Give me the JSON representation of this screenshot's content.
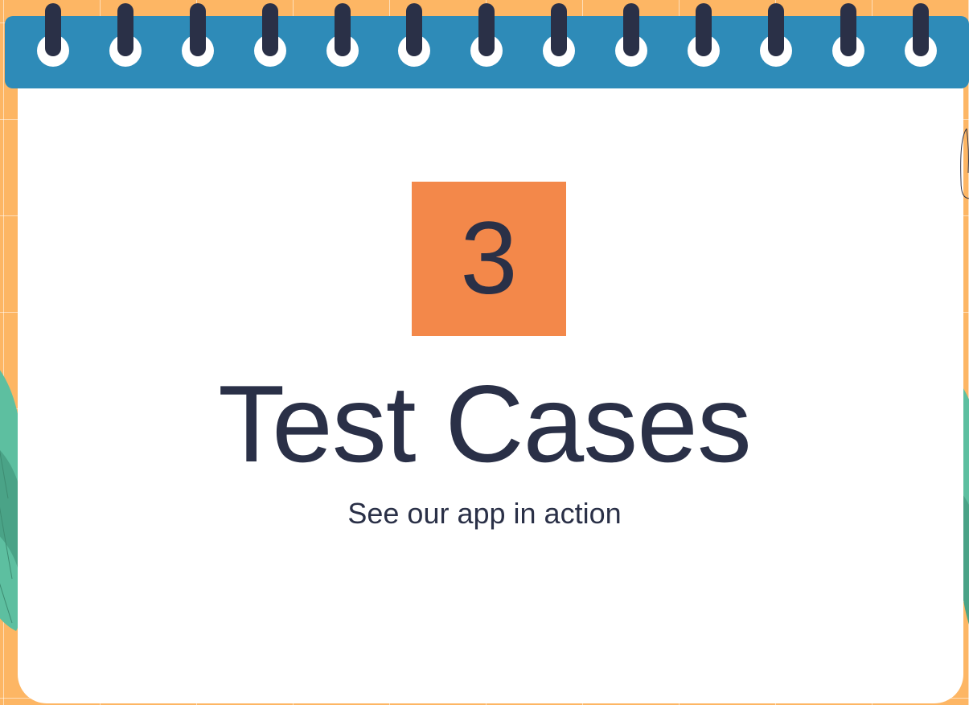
{
  "slide": {
    "number": "3",
    "title": "Test Cases",
    "subtitle": "See our app in action"
  },
  "colors": {
    "background": "#FDB664",
    "binder_bar": "#2E8BB8",
    "number_box": "#F3884A",
    "text": "#2A3047",
    "leaf": "#5DBFA0"
  },
  "decorations": {
    "binder_ring_count": 13,
    "icons": [
      "binder-ring-icon",
      "leaf-icon",
      "pencil-doodle-icon"
    ]
  }
}
